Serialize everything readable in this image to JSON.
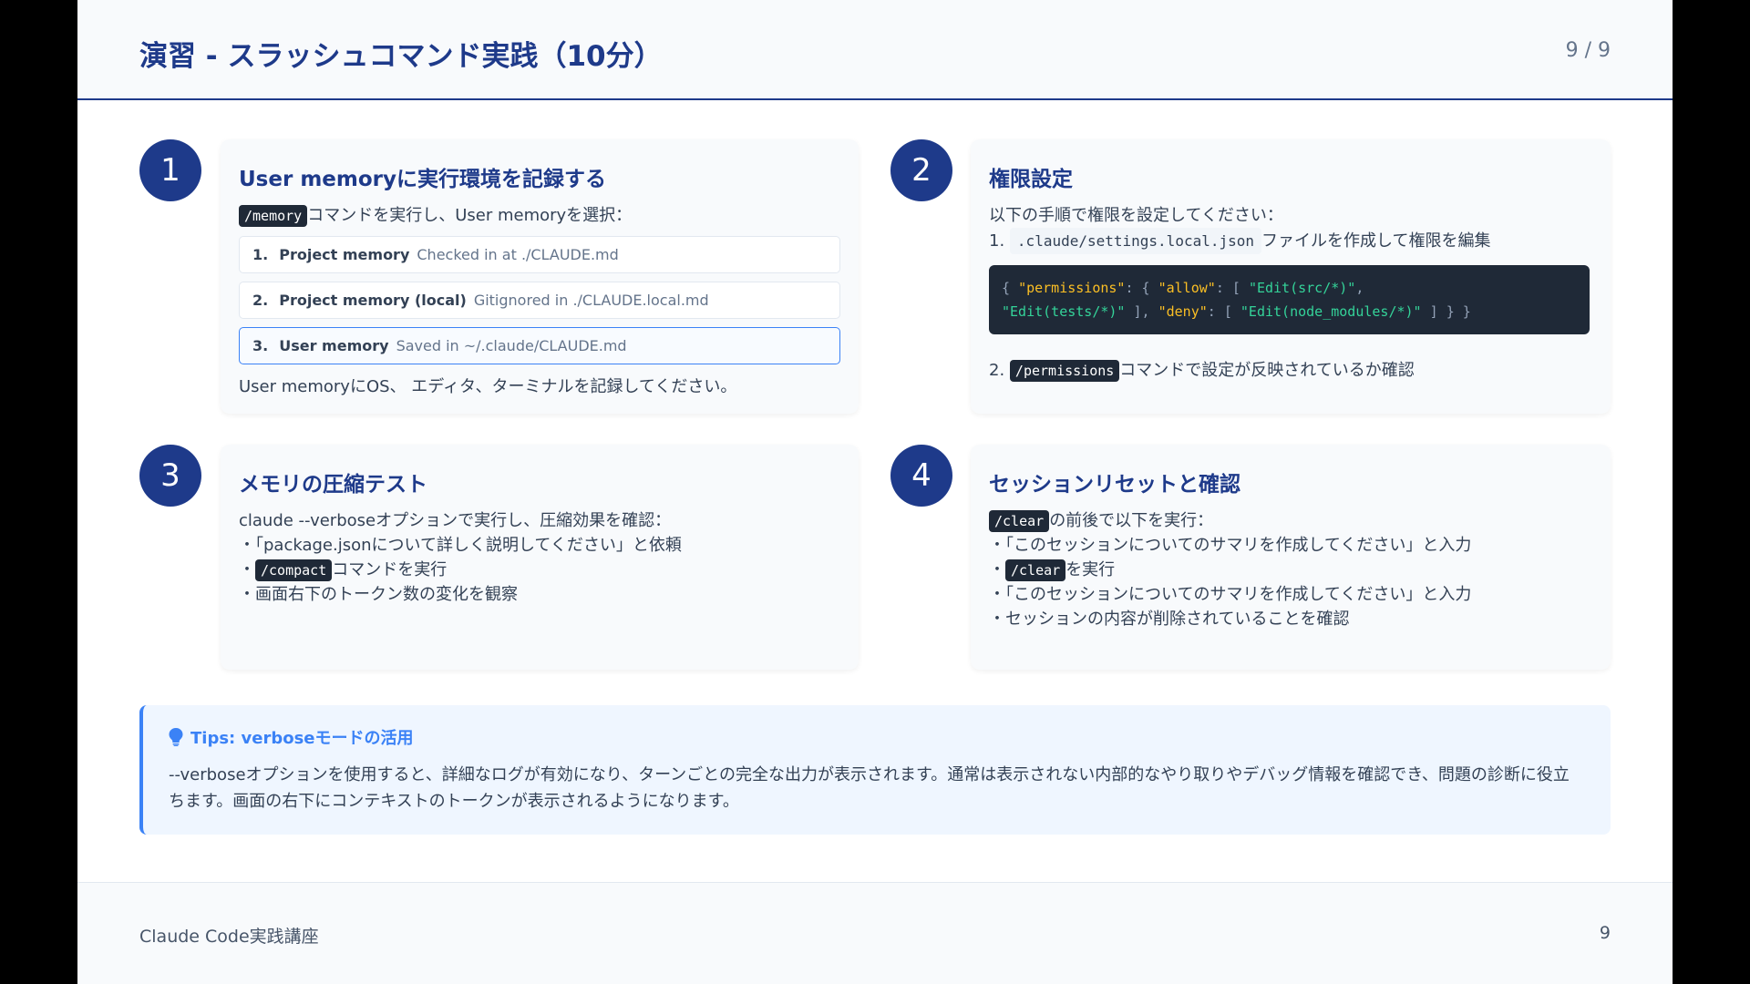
{
  "header": {
    "title": "演習 - スラッシュコマンド実践（10分）",
    "page": "9 / 9"
  },
  "steps": [
    {
      "number": "1",
      "title": "User memoryに実行環境を記録する",
      "intro_cmd": "/memory",
      "intro_text": "コマンドを実行し、User memoryを選択：",
      "options": [
        {
          "no": "1.",
          "name": "Project memory",
          "desc": "Checked in at ./CLAUDE.md",
          "selected": false
        },
        {
          "no": "2.",
          "name": "Project memory (local)",
          "desc": "Gitignored in ./CLAUDE.local.md",
          "selected": false
        },
        {
          "no": "3.",
          "name": "User memory",
          "desc": "Saved in ~/.claude/CLAUDE.md",
          "selected": true
        }
      ],
      "note": "User memoryにOS、 エディタ、ターミナルを記録してください。"
    },
    {
      "number": "2",
      "title": "権限設定",
      "intro": "以下の手順で権限を設定してください：",
      "step1_prefix": "1.",
      "step1_file": ".claude/settings.local.json",
      "step1_text": "ファイルを作成して権限を編集",
      "code": {
        "brace_open": "{",
        "permissions_key": "\"permissions\"",
        "colon": ":",
        "brace_open2": "{",
        "allow_key": "\"allow\"",
        "bracket_open": "[",
        "allow_1": "\"Edit(src/*)\"",
        "comma": ",",
        "allow_2": "\"Edit(tests/*)\"",
        "bracket_close": "]",
        "deny_key": "\"deny\"",
        "deny_1": "\"Edit(node_modules/*)\"",
        "brace_close": "}"
      },
      "step2_prefix": "2.",
      "step2_cmd": "/permissions",
      "step2_text": "コマンドで設定が反映されているか確認"
    },
    {
      "number": "3",
      "title": "メモリの圧縮テスト",
      "intro": "claude --verboseオプションで実行し、圧縮効果を確認：",
      "bullet1": "・「package.jsonについて詳しく説明してください」と依頼",
      "bullet2_prefix": "・",
      "bullet2_cmd": "/compact",
      "bullet2_text": "コマンドを実行",
      "bullet3": "・画面右下のトークン数の変化を観察"
    },
    {
      "number": "4",
      "title": "セッションリセットと確認",
      "intro_cmd": "/clear",
      "intro_text": "の前後で以下を実行：",
      "bullet1": "・「このセッションについてのサマリを作成してください」と入力",
      "bullet2_prefix": "・",
      "bullet2_cmd": "/clear",
      "bullet2_text": "を実行",
      "bullet3": "・「このセッションについてのサマリを作成してください」と入力",
      "bullet4": "・セッションの内容が削除されていることを確認"
    }
  ],
  "tips": {
    "icon": "lightbulb-icon",
    "title": "Tips: verboseモードの活用",
    "body": "--verboseオプションを使用すると、詳細なログが有効になり、ターンごとの完全な出力が表示されます。通常は表示されない内部的なやり取りやデバッグ情報を確認でき、問題の診断に役立ちます。画面の右下にコンテキストのトークンが表示されるようになります。"
  },
  "footer": {
    "course": "Claude Code実践講座",
    "page": "9"
  },
  "colors": {
    "accent": "#1e3a8a",
    "tips_accent": "#3b82f6"
  }
}
